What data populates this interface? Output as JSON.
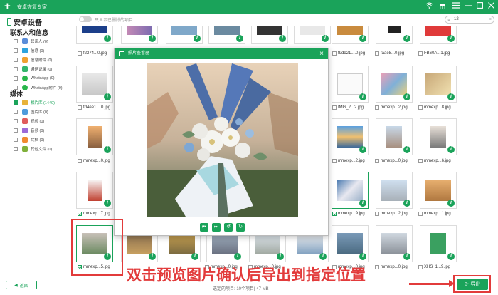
{
  "app": {
    "title": "安卓恢复专家",
    "logo": "+"
  },
  "window_controls": [
    "wifi-icon",
    "gift-icon",
    "menu-icon",
    "minimize-icon",
    "maximize-icon",
    "close-icon"
  ],
  "sidebar": {
    "device": "安卓设备",
    "sections": [
      {
        "title": "联系人和信息",
        "items": [
          {
            "label": "联系人 (0)",
            "color": "#5b8dd9",
            "checked": false
          },
          {
            "label": "信息 (0)",
            "color": "#2da3de",
            "checked": false
          },
          {
            "label": "信息附件 (0)",
            "color": "#f0a030",
            "checked": false
          },
          {
            "label": "通话记录 (0)",
            "color": "#35b56b",
            "checked": false
          },
          {
            "label": "WhatsApp (0)",
            "color": "#29b64a",
            "checked": false
          },
          {
            "label": "WhatsApp附件 (0)",
            "color": "#29b64a",
            "checked": false
          }
        ]
      },
      {
        "title": "媒体",
        "items": [
          {
            "label": "相片库 (1440)",
            "color": "#e8b23a",
            "checked": true,
            "selected": true
          },
          {
            "label": "图片库 (0)",
            "color": "#4e9bdc",
            "checked": false
          },
          {
            "label": "视频 (0)",
            "color": "#e05c5c",
            "checked": false
          },
          {
            "label": "音频 (0)",
            "color": "#9c6ad8",
            "checked": false
          },
          {
            "label": "文档 (0)",
            "color": "#f08a30",
            "checked": false
          },
          {
            "label": "其他文件 (0)",
            "color": "#7fb03a",
            "checked": false
          }
        ]
      }
    ],
    "back_label": "返回"
  },
  "toolbar": {
    "toggle_label": "只显示已删除的项目",
    "search_value": "12"
  },
  "grid": {
    "captions": [
      {
        "text": "f2274...0.jpg",
        "checked": false
      },
      {
        "text": "f9d921....0.jpg",
        "checked": false
      },
      {
        "text": "faae8...0.jpg",
        "checked": false
      },
      {
        "text": "FB60A...1.jpg",
        "checked": false
      },
      {
        "text": "fd4ee1....0.jpg",
        "checked": false
      },
      {
        "text": "IMG_2...2.jpg",
        "checked": false
      },
      {
        "text": "mmexp...2.jpg",
        "checked": false
      },
      {
        "text": "mmexp...8.jpg",
        "checked": false
      },
      {
        "text": "mmexp...0.jpg",
        "checked": false
      },
      {
        "text": "mmexp...2.jpg",
        "checked": false
      },
      {
        "text": "mmexp...0.jpg",
        "checked": false
      },
      {
        "text": "mmexp...6.jpg",
        "checked": false
      },
      {
        "text": "mmexp...7.jpg",
        "checked": true
      },
      {
        "text": "mmexp...9.jpg",
        "checked": true
      },
      {
        "text": "mmexp...2.jpg",
        "checked": false
      },
      {
        "text": "mmexp...1.jpg",
        "checked": false
      },
      {
        "text": "mmexp...5.jpg",
        "checked": true
      },
      {
        "text": "mmexp...0.jpg",
        "checked": false
      },
      {
        "text": "mmexp...0.jpg",
        "checked": false
      },
      {
        "text": "mmexp...9.jpg",
        "checked": false
      },
      {
        "text": "mmexp...9.jpg",
        "checked": false
      },
      {
        "text": "mmexp...1.jpg",
        "checked": false
      },
      {
        "text": "mmexp...0.jpg",
        "checked": false
      },
      {
        "text": "mmexp...0.jpg",
        "checked": false
      },
      {
        "text": "XHS_1...9.jpg",
        "checked": false
      }
    ],
    "info_badge": "i"
  },
  "viewer": {
    "title": "照片查看器",
    "close": "×",
    "controls": [
      "first-icon",
      "last-icon",
      "rotate-left-icon",
      "rotate-right-icon"
    ],
    "control_glyphs": [
      "⏮",
      "⏭",
      "↺",
      "↻"
    ]
  },
  "footer": {
    "status": "选定的项目: 10个项目| 47 MB",
    "export_label": "导出"
  },
  "annotation": {
    "text": "双击预览图片确认后导出到指定位置"
  }
}
